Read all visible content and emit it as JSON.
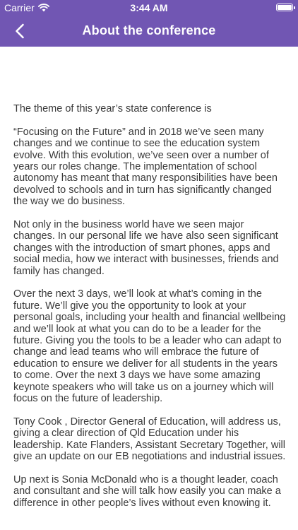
{
  "status_bar": {
    "carrier": "Carrier",
    "time": "3:44 AM"
  },
  "nav": {
    "title": "About the conference",
    "back_icon": "chevron-left-icon"
  },
  "colors": {
    "header_bg": "#7156b3",
    "body_text": "#3a3a3a"
  },
  "content": {
    "paragraphs": [
      "The theme of this year’s state conference is",
      "“Focusing on the Future” and in 2018 we’ve seen many changes and we continue to see the education system evolve. With this evolution, we’ve seen over a number of years our roles change. The implementation of school autonomy has meant that many responsibilities have been devolved to schools and in turn has significantly changed the way we do business.",
      "Not only in the business world have we seen major changes.  In our personal life we have also seen significant changes with the introduction of smart phones, apps and social media, how we interact with businesses, friends and family has changed.",
      "Over the next 3 days, we’ll look at what’s coming in the future.  We’ll give you the opportunity to look at your personal goals, including your health and financial wellbeing and we’ll look at what you can do to be a leader for the future.  Giving you the tools to be a leader who can adapt to change and lead teams who will embrace the future of education to ensure we deliver for all students in the years to come.  Over the next 3 days we have some amazing keynote speakers who will take us on a journey which will focus on the future of leadership.",
      "Tony Cook , Director General of Education, will address us, giving a clear direction of Qld Education under his leadership.  Kate Flanders, Assistant Secretary Together, will give an update on our EB negotiations and industrial issues.",
      "Up next is Sonia McDonald who is a thought leader, coach and consultant and she will talk how easily you can make a difference in other people’s lives without even knowing it."
    ]
  }
}
